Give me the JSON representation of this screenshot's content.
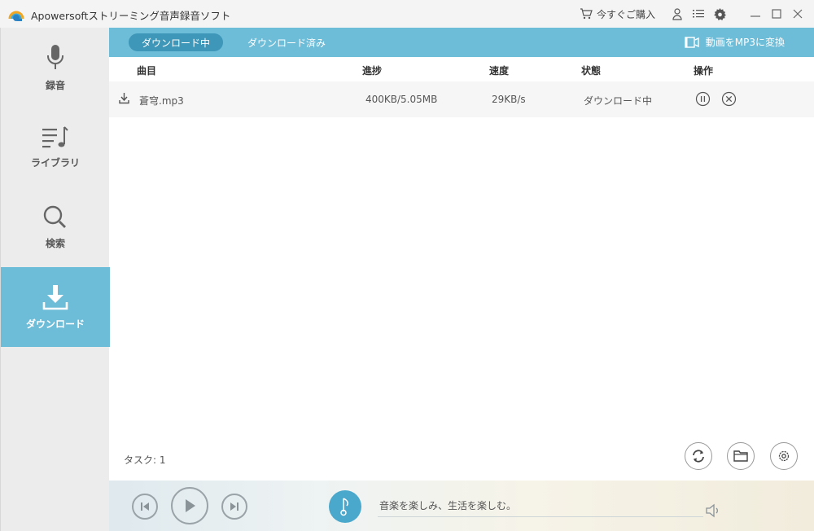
{
  "window": {
    "title": "Apowersoftストリーミング音声録音ソフト",
    "buy_now": "今すぐご購入"
  },
  "sidebar": {
    "items": [
      {
        "label": "録音",
        "icon": "microphone-icon"
      },
      {
        "label": "ライブラリ",
        "icon": "music-list-icon"
      },
      {
        "label": "検索",
        "icon": "search-icon"
      },
      {
        "label": "ダウンロード",
        "icon": "download-icon",
        "active": true
      }
    ]
  },
  "tabs": {
    "downloading": "ダウンロード中",
    "downloaded": "ダウンロード済み",
    "convert": "動画をMP3に変換"
  },
  "table": {
    "columns": [
      "曲目",
      "進捗",
      "速度",
      "状態",
      "操作"
    ],
    "rows": [
      {
        "title": "蒼穹.mp3",
        "progress": "400KB/5.05MB",
        "speed": "29KB/s",
        "status": "ダウンロード中"
      }
    ]
  },
  "footer": {
    "task_count": "タスク: 1"
  },
  "player": {
    "slogan": "音楽を楽しみ、生活を楽しむ。"
  },
  "colors": {
    "accent": "#6dbcd8",
    "accent_dark": "#3e97b8",
    "sidebar_bg": "#ececec"
  }
}
